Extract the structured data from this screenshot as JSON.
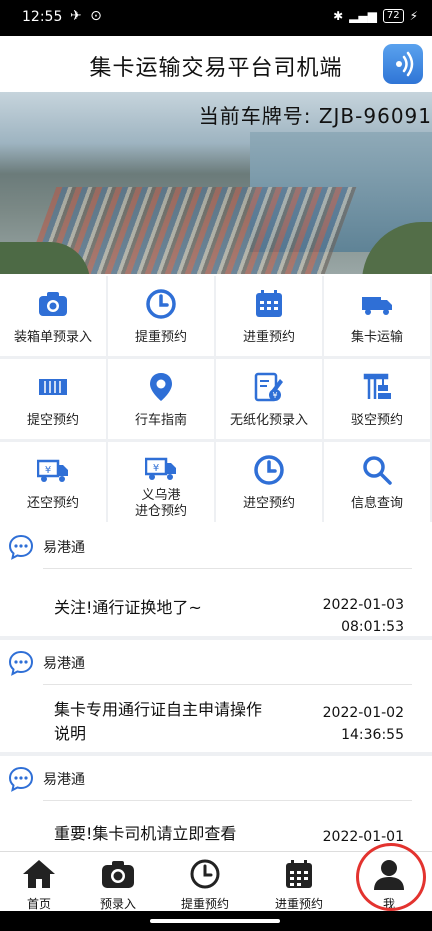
{
  "status_bar": {
    "time": "12:55",
    "battery": "72"
  },
  "header": {
    "title": "集卡运输交易平台司机端"
  },
  "banner": {
    "plate_label": "当前车牌号: ZJB-96091"
  },
  "colors": {
    "accent": "#2f6fd6",
    "highlight": "#e3332f"
  },
  "menu": [
    {
      "label": "装箱单预录入",
      "icon": "camera-icon"
    },
    {
      "label": "提重预约",
      "icon": "clock-icon"
    },
    {
      "label": "进重预约",
      "icon": "calendar-icon"
    },
    {
      "label": "集卡运输",
      "icon": "truck-icon"
    },
    {
      "label": "提空预约",
      "icon": "container-icon"
    },
    {
      "label": "行车指南",
      "icon": "map-pin-icon"
    },
    {
      "label": "无纸化预录入",
      "icon": "edit-doc-icon"
    },
    {
      "label": "驳空预约",
      "icon": "crane-icon"
    },
    {
      "label": "还空预约",
      "icon": "truck-money-icon"
    },
    {
      "label": "义乌港\n进仓预约",
      "icon": "truck-money-icon"
    },
    {
      "label": "进空预约",
      "icon": "clock-icon"
    },
    {
      "label": "信息查询",
      "icon": "search-icon"
    }
  ],
  "messages": [
    {
      "source": "易港通",
      "text": "关注!通行证换地了~",
      "date": "2022-01-03",
      "time": "08:01:53"
    },
    {
      "source": "易港通",
      "text": "集卡专用通行证自主申请操作说明",
      "date": "2022-01-02",
      "time": "14:36:55"
    },
    {
      "source": "易港通",
      "text": "重要!集卡司机请立即查看",
      "date": "2022-01-01",
      "time": ""
    }
  ],
  "tabs": [
    {
      "label": "首页",
      "icon": "home-icon"
    },
    {
      "label": "预录入",
      "icon": "camera-icon"
    },
    {
      "label": "提重预约",
      "icon": "clock-icon"
    },
    {
      "label": "进重预约",
      "icon": "calendar-icon"
    },
    {
      "label": "我",
      "icon": "user-icon"
    }
  ]
}
